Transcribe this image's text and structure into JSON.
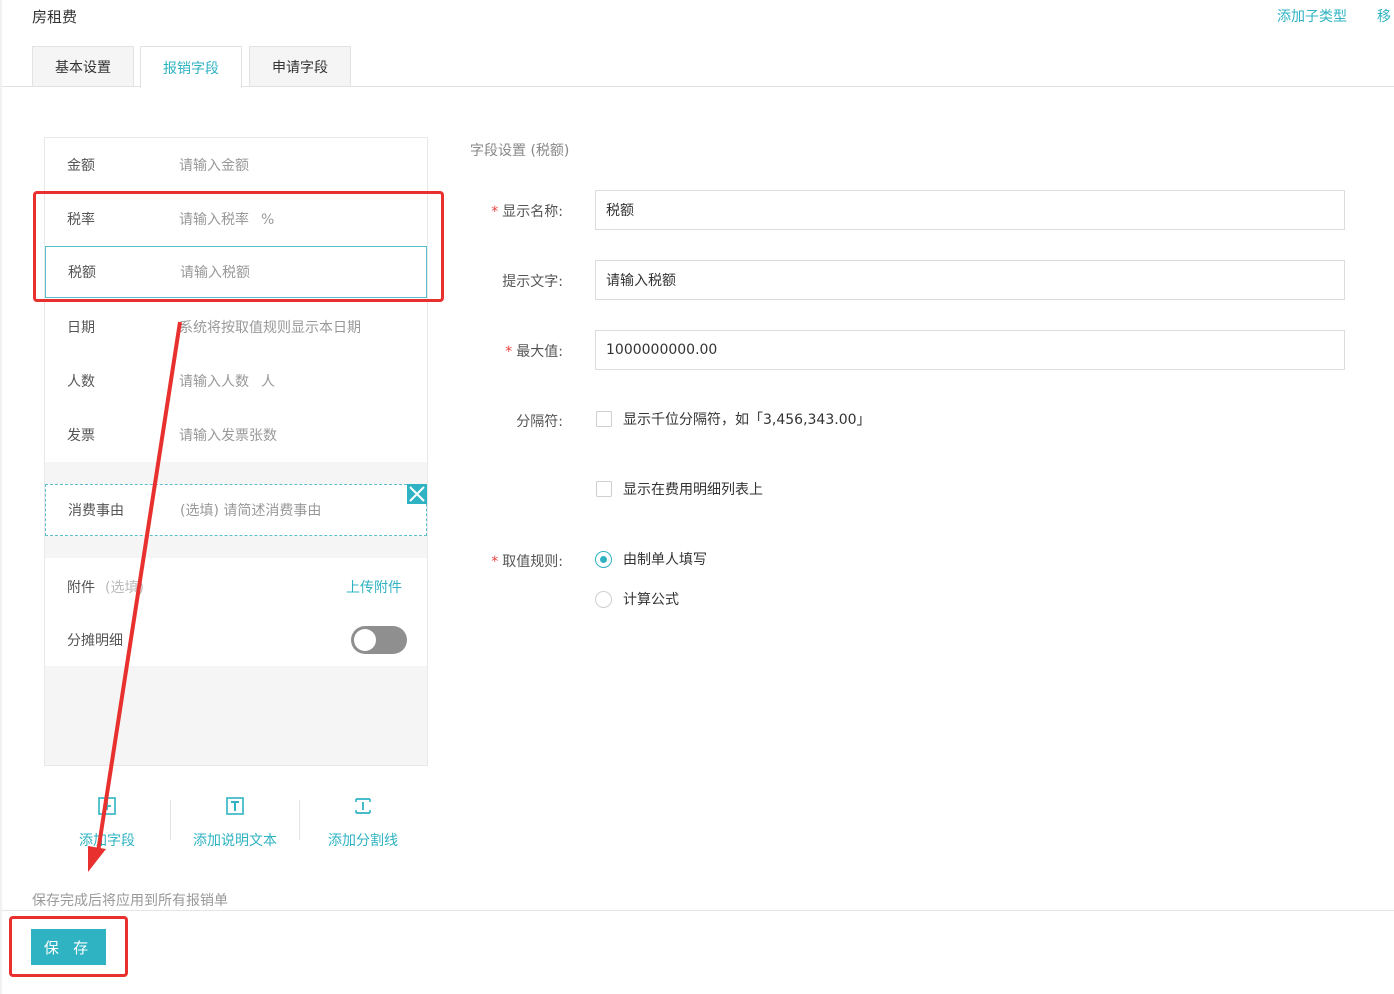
{
  "header": {
    "title": "房租费",
    "add_subtype": "添加子类型",
    "move": "移"
  },
  "tabs": [
    {
      "label": "基本设置",
      "active": false
    },
    {
      "label": "报销字段",
      "active": true
    },
    {
      "label": "申请字段",
      "active": false
    }
  ],
  "preview": {
    "fields": [
      {
        "label": "金额",
        "placeholder": "请输入金额",
        "unit": ""
      },
      {
        "label": "税率",
        "placeholder": "请输入税率",
        "unit": "%"
      },
      {
        "label": "税额",
        "placeholder": "请输入税额",
        "unit": ""
      },
      {
        "label": "日期",
        "placeholder": "系统将按取值规则显示本日期",
        "unit": ""
      },
      {
        "label": "人数",
        "placeholder": "请输入人数",
        "unit": "人"
      },
      {
        "label": "发票",
        "placeholder": "请输入发票张数",
        "unit": ""
      }
    ],
    "reason": {
      "label": "消费事由",
      "placeholder": "(选填) 请简述消费事由"
    },
    "attachment": {
      "label": "附件",
      "optional": "(选填)",
      "upload": "上传附件"
    },
    "split": {
      "label": "分摊明细",
      "enabled": false
    }
  },
  "actions": {
    "add_field": "添加字段",
    "add_text": "添加说明文本",
    "add_divider": "添加分割线"
  },
  "footer": {
    "note": "保存完成后将应用到所有报销单",
    "save": "保 存"
  },
  "settings": {
    "title": "字段设置 (税额)",
    "display_name": {
      "label": "显示名称:",
      "value": "税额",
      "required": true
    },
    "hint_text": {
      "label": "提示文字:",
      "value": "请输入税额",
      "required": false
    },
    "max_value": {
      "label": "最大值:",
      "value": "1000000000.00",
      "required": true
    },
    "separator": {
      "label": "分隔符:",
      "option": "显示千位分隔符，如「3,456,343.00」",
      "checked": false
    },
    "show_in_list": {
      "option": "显示在费用明细列表上",
      "checked": false
    },
    "value_rule": {
      "label": "取值规则:",
      "required": true,
      "options": [
        "由制单人填写",
        "计算公式"
      ],
      "selected": 0
    },
    "required_mark": "*"
  },
  "colors": {
    "accent": "#2fb3c3",
    "annotation": "#e8312f",
    "required": "#e9423f"
  }
}
